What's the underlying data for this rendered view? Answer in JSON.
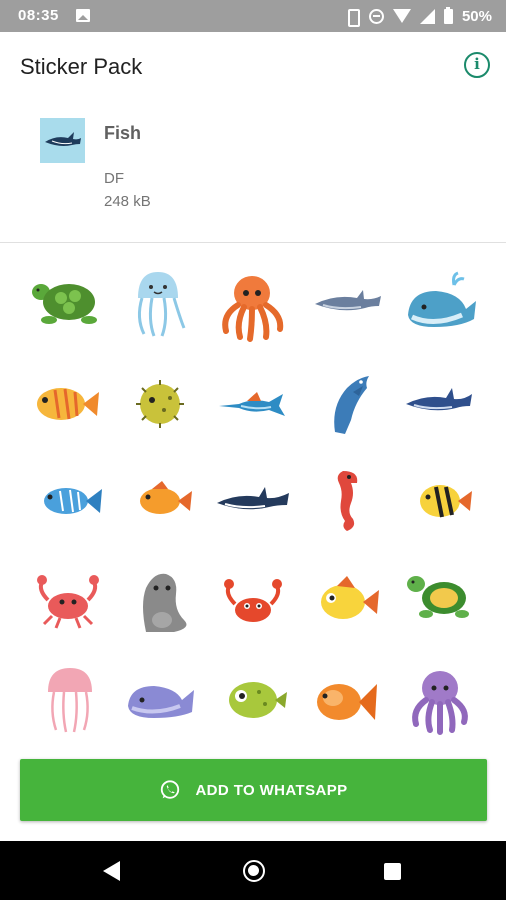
{
  "status_bar": {
    "time": "08:35",
    "battery": "50%",
    "icons": [
      "photo-icon",
      "vibrate-icon",
      "do-not-disturb-icon",
      "wifi-icon",
      "signal-icon",
      "battery-icon"
    ]
  },
  "app_bar": {
    "title": "Sticker Pack",
    "info_icon": "info-icon",
    "info_color": "#1b8a6b"
  },
  "pack": {
    "title": "Fish",
    "author": "DF",
    "size": "248 kB",
    "thumbnail_icon": "shark-thumbnail"
  },
  "stickers": [
    "turtle",
    "jellyfish",
    "octopus",
    "shark",
    "whale",
    "orange-fish",
    "pufferfish",
    "swordfish",
    "dolphin",
    "shark",
    "blue-fish",
    "orange-fish",
    "shark",
    "seahorse",
    "angelfish",
    "crab",
    "seal",
    "crab",
    "yellow-fish",
    "turtle",
    "jellyfish",
    "whale",
    "pufferfish",
    "goldfish",
    "octopus"
  ],
  "add_button": {
    "label": "ADD TO WHATSAPP",
    "icon": "whatsapp-icon",
    "color": "#46b43c"
  },
  "nav_bar": {
    "icons": [
      "back-icon",
      "home-icon",
      "recents-icon"
    ]
  }
}
